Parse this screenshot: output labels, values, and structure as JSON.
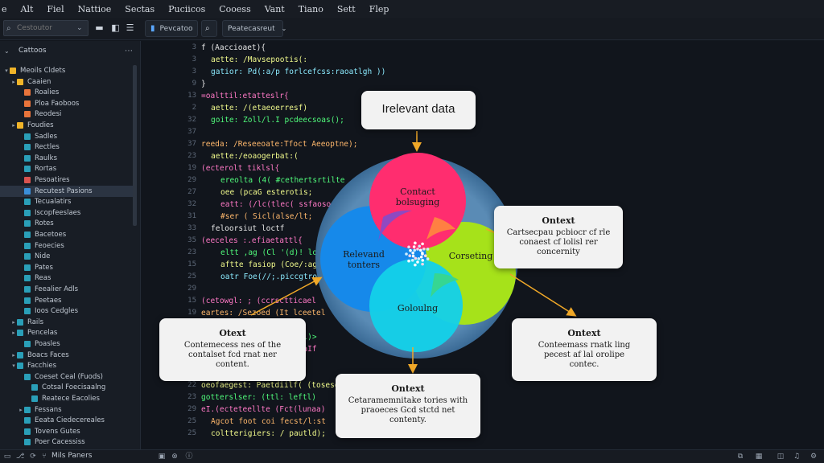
{
  "menu": [
    "e",
    "Alt",
    "Fiel",
    "Nattioe",
    "Sectas",
    "Puciicos",
    "Cooess",
    "Vant",
    "Tiano",
    "Sett",
    "Flep"
  ],
  "toolbar": {
    "search_placeholder": "Cestoutor",
    "tab1_label": "Pevcatoo",
    "tab2_label": "Peatecasreut"
  },
  "sidebar": {
    "title": "Cattoos",
    "items": [
      {
        "label": "Meoils Cldets",
        "icon": "folder",
        "arrow": "▾",
        "indent": 0
      },
      {
        "label": "Caaien",
        "icon": "folder",
        "arrow": "▸",
        "indent": 1
      },
      {
        "label": "Roalies",
        "icon": "orange",
        "arrow": "",
        "indent": 2
      },
      {
        "label": "Ploa Faoboos",
        "icon": "orange",
        "arrow": "",
        "indent": 2
      },
      {
        "label": "Reodesi",
        "icon": "orange",
        "arrow": "",
        "indent": 2
      },
      {
        "label": "Foudies",
        "icon": "folder",
        "arrow": "▸",
        "indent": 1
      },
      {
        "label": "Sadles",
        "icon": "teal",
        "arrow": "",
        "indent": 2
      },
      {
        "label": "Rectles",
        "icon": "teal",
        "arrow": "",
        "indent": 2
      },
      {
        "label": "Raulks",
        "icon": "teal",
        "arrow": "",
        "indent": 2
      },
      {
        "label": "Rortas",
        "icon": "teal",
        "arrow": "",
        "indent": 2
      },
      {
        "label": "Pesoatires",
        "icon": "red",
        "arrow": "",
        "indent": 2
      },
      {
        "label": "Recutest Pasions",
        "icon": "blue",
        "arrow": "",
        "indent": 2,
        "selected": true
      },
      {
        "label": "Tecualatirs",
        "icon": "teal",
        "arrow": "",
        "indent": 2
      },
      {
        "label": "Iscopfeeslaes",
        "icon": "teal",
        "arrow": "",
        "indent": 2
      },
      {
        "label": "Rotes",
        "icon": "teal",
        "arrow": "",
        "indent": 2
      },
      {
        "label": "Bacetoes",
        "icon": "teal",
        "arrow": "",
        "indent": 2
      },
      {
        "label": "Feoecies",
        "icon": "teal",
        "arrow": "",
        "indent": 2
      },
      {
        "label": "Nide",
        "icon": "teal",
        "arrow": "",
        "indent": 2
      },
      {
        "label": "Pates",
        "icon": "teal",
        "arrow": "",
        "indent": 2
      },
      {
        "label": "Reas",
        "icon": "teal",
        "arrow": "",
        "indent": 2
      },
      {
        "label": "Feealier Adls",
        "icon": "teal",
        "arrow": "",
        "indent": 2
      },
      {
        "label": "Peetaes",
        "icon": "teal",
        "arrow": "",
        "indent": 2
      },
      {
        "label": "Ioos Cedgles",
        "icon": "teal",
        "arrow": "",
        "indent": 2
      },
      {
        "label": "Rails",
        "icon": "teal",
        "arrow": "▸",
        "indent": 1
      },
      {
        "label": "Pencelas",
        "icon": "teal",
        "arrow": "▸",
        "indent": 1
      },
      {
        "label": "Poasles",
        "icon": "teal",
        "arrow": "",
        "indent": 2
      },
      {
        "label": "Boacs Faces",
        "icon": "teal",
        "arrow": "▸",
        "indent": 1
      },
      {
        "label": "Facchies",
        "icon": "teal",
        "arrow": "▾",
        "indent": 1
      },
      {
        "label": "Coeset Ceal (Fuods)",
        "icon": "teal",
        "arrow": "",
        "indent": 2
      },
      {
        "label": "Cotsal Foecisaalng",
        "icon": "teal",
        "arrow": "",
        "indent": 3
      },
      {
        "label": "Reatece Eacolies",
        "icon": "teal",
        "arrow": "",
        "indent": 3
      },
      {
        "label": "Fessans",
        "icon": "teal",
        "arrow": "▸",
        "indent": 2
      },
      {
        "label": "Eeata Ciedecereales",
        "icon": "teal",
        "arrow": "",
        "indent": 2
      },
      {
        "label": "Tovens Gutes",
        "icon": "teal",
        "arrow": "",
        "indent": 2
      },
      {
        "label": "Poer Cacessiss",
        "icon": "teal",
        "arrow": "",
        "indent": 2
      }
    ]
  },
  "editor": {
    "line_numbers": [
      "3",
      "3",
      "3",
      "9",
      "13",
      "2",
      "32",
      "37",
      "37",
      "23",
      "19",
      "29",
      "27",
      "32",
      "31",
      "33",
      "35",
      "23",
      "15",
      "25",
      "29",
      "15",
      "19",
      "19",
      "16",
      "15",
      "17",
      "29",
      "22",
      "23",
      "29",
      "25",
      "25",
      "25",
      "27",
      "29"
    ],
    "code_lines": [
      {
        "text": "f (Aaccioaet){",
        "color": "c-white",
        "indent": 0
      },
      {
        "text": "aette: /Mavsepootis(:",
        "color": "c-yellow",
        "indent": 1
      },
      {
        "text": "gatior: Pd(:a/p  forlcefcss:raoatlgh ))",
        "color": "c-cyan",
        "indent": 1
      },
      {
        "text": "}",
        "color": "c-white",
        "indent": 0
      },
      {
        "text": "=oalttil:etatteslr{",
        "color": "c-pink",
        "indent": 0
      },
      {
        "text": "aette: /(etaeoerresf)",
        "color": "c-yellow",
        "indent": 1
      },
      {
        "text": "goite: Zoll/l.I  pcdeecsoas();",
        "color": "c-green",
        "indent": 1
      },
      {
        "text": "",
        "color": "c-white",
        "indent": 0
      },
      {
        "text": "reeda: /Reseeoate:Tfoct Aeeoptne);",
        "color": "c-orange",
        "indent": 0
      },
      {
        "text": "aette:/eoaogerbat:(",
        "color": "c-yellow",
        "indent": 1
      },
      {
        "text": "(ecterolt  tiklsl{",
        "color": "c-pink",
        "indent": 0
      },
      {
        "text": "ereolta (4(  #cethertsrtilte",
        "color": "c-green",
        "indent": 2
      },
      {
        "text": "oee  (pcaG esterotis;",
        "color": "c-yellow",
        "indent": 2
      },
      {
        "text": "eatt: (/lc(tlec( ssfaosoeryl",
        "color": "c-pink",
        "indent": 2
      },
      {
        "text": "#ser  ( Sicl(alse/lt;",
        "color": "c-orange",
        "indent": 2
      },
      {
        "text": "feloorsiut  loctf",
        "color": "c-white",
        "indent": 1
      },
      {
        "text": "(eeceles  :.efiaetattl{",
        "color": "c-pink",
        "indent": 0
      },
      {
        "text": "eltt  ,ag (Cl '(d)! lorf",
        "color": "c-green",
        "indent": 2
      },
      {
        "text": "aftte  fasiop (Coe/:agsy;",
        "color": "c-yellow",
        "indent": 2
      },
      {
        "text": "oatr  Foe(//;.piccgtrotsy",
        "color": "c-cyan",
        "indent": 2
      },
      {
        "text": "",
        "color": "c-white",
        "indent": 0
      },
      {
        "text": "(cetowgl:  ; (ccrsctticael",
        "color": "c-pink",
        "indent": 0
      },
      {
        "text": "eartes: /Sezoed (It lceetel",
        "color": "c-orange",
        "indent": 0
      },
      {
        "text": "Ge(eteer/  ofaceaaa/(",
        "color": "c-yellow",
        "indent": 1
      },
      {
        "text": "goiteeel:  cccedct(adl)>",
        "color": "c-green",
        "indent": 1
      },
      {
        "text": "eatteeel:  (tecettel:aIf",
        "color": "c-pink",
        "indent": 1
      },
      {
        "text": "altees/[  ctetelf",
        "color": "c-cyan",
        "indent": 1
      },
      {
        "text": "aeoTe+I::eteecpegt(",
        "color": "c-orange",
        "indent": 0
      },
      {
        "text": "oeofaegest: Paetdiilf(  (tosesd",
        "color": "c-yellow",
        "indent": 0
      },
      {
        "text": "gotterslser: (ttl: leftl)",
        "color": "c-green",
        "indent": 0
      },
      {
        "text": "eI.(ecteteellte  (Fct(lunaa)",
        "color": "c-pink",
        "indent": 0
      },
      {
        "text": "Agcot  foot coi  fecst/l:st",
        "color": "c-orange",
        "indent": 1
      },
      {
        "text": "coltterigiers: / pautld);",
        "color": "c-yellow",
        "indent": 1
      }
    ]
  },
  "diagram": {
    "circles": {
      "top": "Contact\nbolsuging",
      "left": "Relevand\ntonters",
      "right": "Corseting",
      "bottom": "Goloulng"
    },
    "colors": {
      "pink": "#ff2d6f",
      "blue": "#1689ea",
      "green": "#a6e21a",
      "cyan": "#14d0e8",
      "outer": "#5f8fb7"
    },
    "callouts": {
      "top": {
        "title": "Irelevant data",
        "body": ""
      },
      "right": {
        "title": "Ontext",
        "body": "Cartsecpau pcbiocr cf rle\nconaest cf lolisl rer\nconcernity"
      },
      "left": {
        "title": "Otext",
        "body": "Contemecess nes of the\ncontalset fcd rnat ner\ncontent."
      },
      "bottom_right": {
        "title": "Ontext",
        "body": "Conteemass rnatk ling\npecest af lal orolipe\ncontec."
      },
      "bottom": {
        "title": "Ontext",
        "body": "Cetaramemnitake tories with\npraoeces Gcd stctd net\ncontenty."
      }
    }
  },
  "status": {
    "text": "Mils Paners"
  }
}
